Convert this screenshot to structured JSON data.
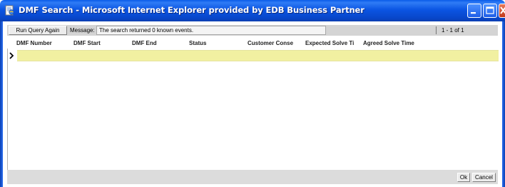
{
  "window": {
    "title": "DMF Search - Microsoft Internet Explorer provided by EDB Business Partner",
    "controls": [
      "minimize",
      "maximize",
      "close"
    ]
  },
  "toolbar": {
    "run_query_label": "Run Query Again",
    "message_label": "Message:",
    "message_text": "The search returned 0 known events.",
    "pager_text": "1 - 1 of 1"
  },
  "table": {
    "columns": [
      "DMF Number",
      "DMF Start",
      "DMF End",
      "Status",
      "Customer Conse",
      "Expected Solve Ti",
      "Agreed Solve Time"
    ],
    "current_row_marker": ">"
  },
  "footer": {
    "ok_label": "Ok",
    "cancel_label": "Cancel"
  },
  "colors": {
    "title_bar": "#0b55e3",
    "selected_row": "#f1f0a1",
    "toolbar_bg": "#d4d4d4"
  }
}
